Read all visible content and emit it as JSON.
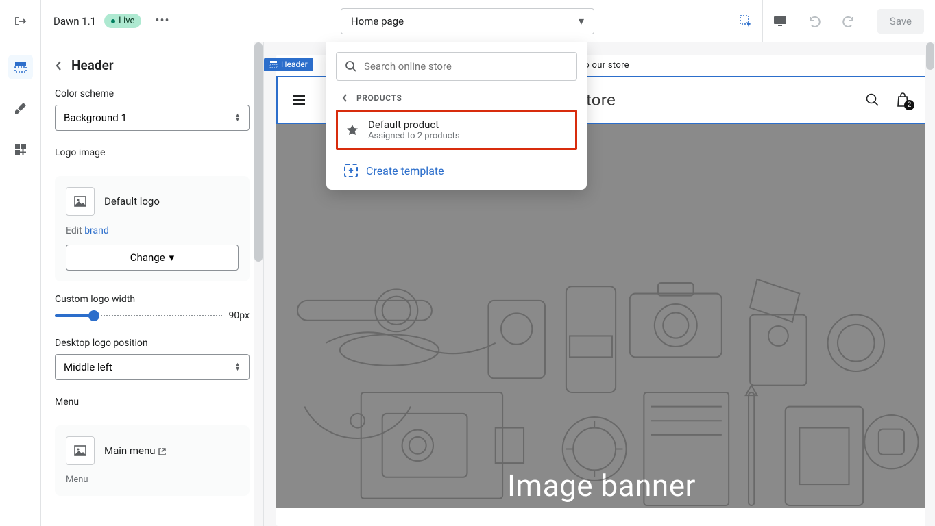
{
  "topbar": {
    "theme_name": "Dawn 1.1",
    "live_label": "Live",
    "template_selected": "Home page",
    "save_label": "Save"
  },
  "dropdown": {
    "search_placeholder": "Search online store",
    "crumb_label": "PRODUCTS",
    "item": {
      "title": "Default product",
      "subtitle": "Assigned to 2 products"
    },
    "create_label": "Create template"
  },
  "sidebar": {
    "title": "Header",
    "color_scheme_label": "Color scheme",
    "color_scheme_value": "Background 1",
    "logo_image_label": "Logo image",
    "logo_name": "Default logo",
    "edit_prefix": "Edit ",
    "edit_link": "brand",
    "change_label": "Change",
    "custom_width_label": "Custom logo width",
    "custom_width_value": "90px",
    "desktop_position_label": "Desktop logo position",
    "desktop_position_value": "Middle left",
    "menu_label": "Menu",
    "menu_value": "Main menu",
    "menu_sublabel": "Menu"
  },
  "preview": {
    "announce_text": "e to our store",
    "header_tag": "Header",
    "store_name": "olestore",
    "cart_count": "2",
    "hero_title": "Image banner"
  }
}
